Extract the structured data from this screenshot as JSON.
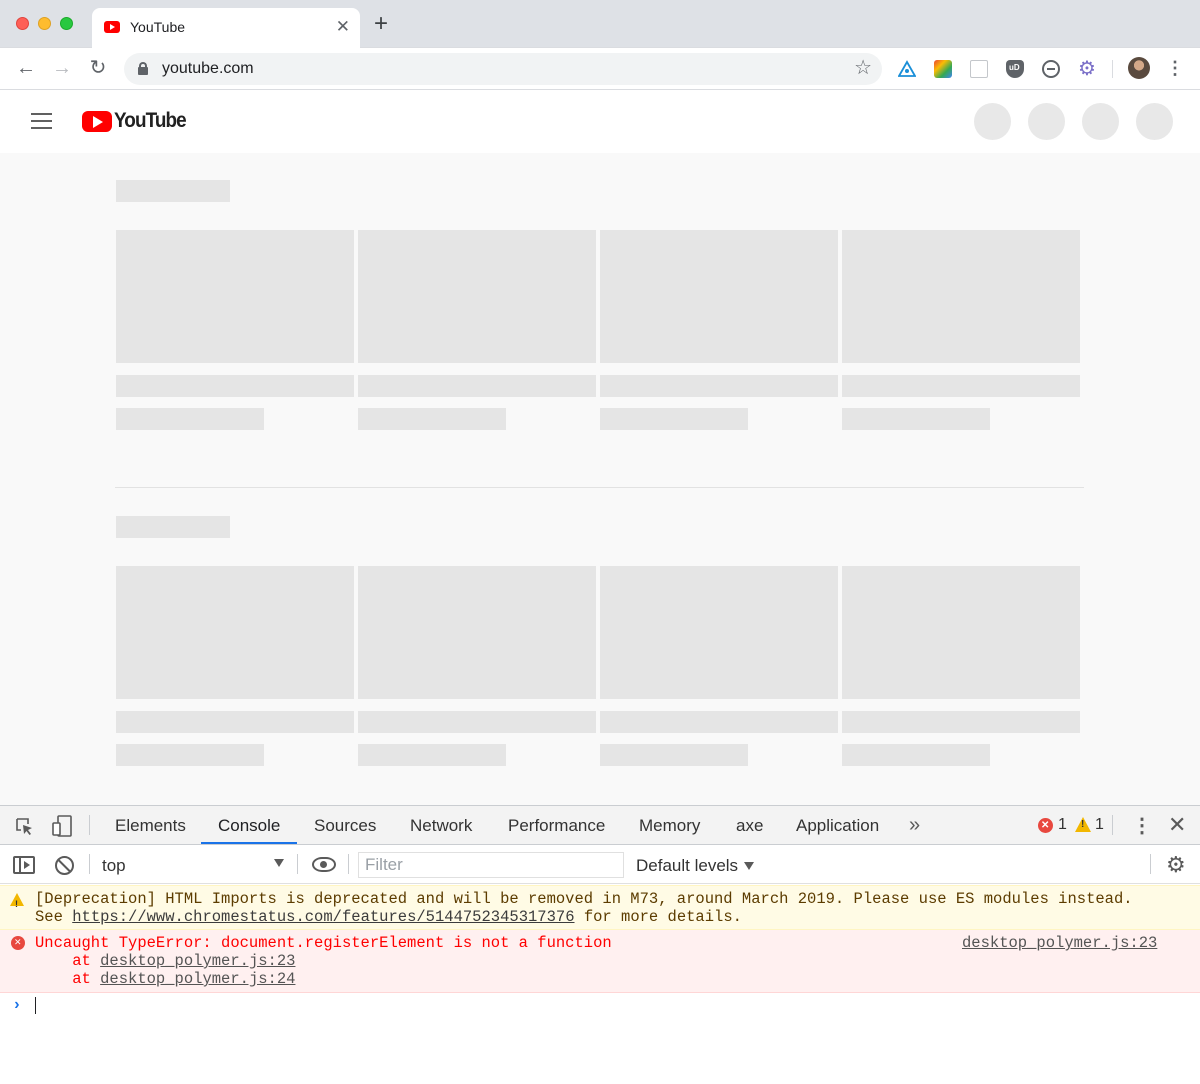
{
  "browser": {
    "tab_title": "YouTube",
    "tab_close": "✕",
    "new_tab": "+",
    "url": "youtube.com",
    "back": "←",
    "forward": "→",
    "reload": "↻",
    "star": "☆",
    "gear": "⚙",
    "menu": "⋮"
  },
  "youtube": {
    "logo_text": "YouTube"
  },
  "devtools": {
    "tabs": [
      "Elements",
      "Console",
      "Sources",
      "Network",
      "Performance",
      "Memory",
      "axe",
      "Application"
    ],
    "active_tab": "Console",
    "more_tabs": "»",
    "error_count": "1",
    "warning_count": "1",
    "kebab": "⋮",
    "close": "✕",
    "context": "top",
    "filter_placeholder": "Filter",
    "levels": "Default levels",
    "settings": "⚙"
  },
  "console": {
    "warning": {
      "line1": "[Deprecation] HTML Imports is deprecated and will be removed in M73, around March 2019. Please use ES modules instead.",
      "line2_prefix": "See ",
      "line2_link": "https://www.chromestatus.com/features/5144752345317376",
      "line2_suffix": " for more details."
    },
    "error": {
      "message": "Uncaught TypeError: document.registerElement is not a function",
      "source": "desktop_polymer.js:23",
      "stack_prefix": "    at ",
      "stack": [
        "desktop_polymer.js:23",
        "desktop_polymer.js:24"
      ]
    },
    "prompt": "›"
  },
  "colors": {
    "youtube_red": "#ff0000",
    "skeleton": "#e5e5e5",
    "devtools_accent": "#1a73e8",
    "error_red": "#ff0000",
    "warning_bg": "#fffbe5",
    "error_bg": "#fff0f0"
  }
}
